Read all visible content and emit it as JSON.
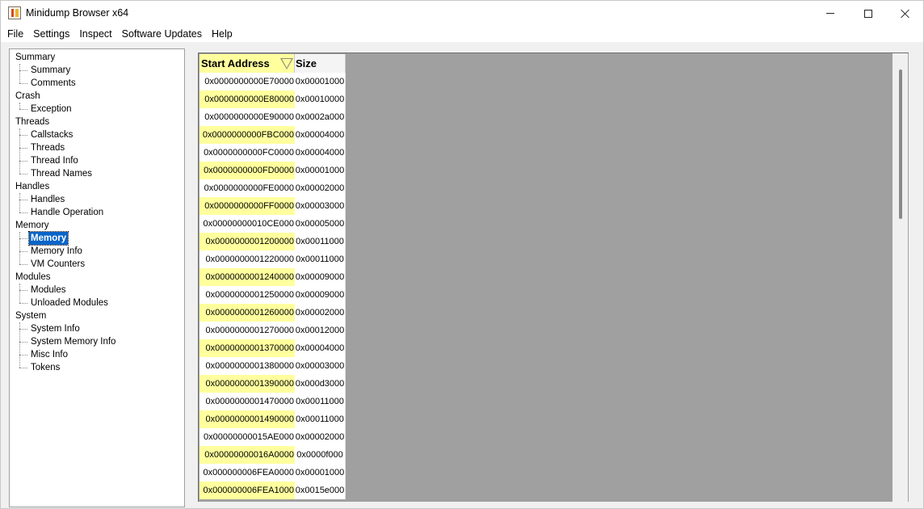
{
  "window": {
    "title": "Minidump Browser x64"
  },
  "menu": [
    {
      "label": "File"
    },
    {
      "label": "Settings"
    },
    {
      "label": "Inspect"
    },
    {
      "label": "Software Updates"
    },
    {
      "label": "Help"
    }
  ],
  "tree": [
    {
      "label": "Summary",
      "children": [
        {
          "label": "Summary"
        },
        {
          "label": "Comments"
        }
      ]
    },
    {
      "label": "Crash",
      "children": [
        {
          "label": "Exception"
        }
      ]
    },
    {
      "label": "Threads",
      "children": [
        {
          "label": "Callstacks"
        },
        {
          "label": "Threads"
        },
        {
          "label": "Thread Info"
        },
        {
          "label": "Thread Names"
        }
      ]
    },
    {
      "label": "Handles",
      "children": [
        {
          "label": "Handles"
        },
        {
          "label": "Handle Operation"
        }
      ]
    },
    {
      "label": "Memory",
      "children": [
        {
          "label": "Memory",
          "selected": true
        },
        {
          "label": "Memory Info"
        },
        {
          "label": "VM Counters"
        }
      ]
    },
    {
      "label": "Modules",
      "children": [
        {
          "label": "Modules"
        },
        {
          "label": "Unloaded Modules"
        }
      ]
    },
    {
      "label": "System",
      "children": [
        {
          "label": "System Info"
        },
        {
          "label": "System Memory Info"
        },
        {
          "label": "Misc Info"
        },
        {
          "label": "Tokens"
        }
      ]
    }
  ],
  "grid": {
    "columns": [
      "Start Address",
      "Size"
    ],
    "sort_column": "Start Address",
    "sort_direction": "descending",
    "rows": [
      [
        "0x0000000000E70000",
        "0x00001000"
      ],
      [
        "0x0000000000E80000",
        "0x00010000"
      ],
      [
        "0x0000000000E90000",
        "0x0002a000"
      ],
      [
        "0x0000000000FBC000",
        "0x00004000"
      ],
      [
        "0x0000000000FC0000",
        "0x00004000"
      ],
      [
        "0x0000000000FD0000",
        "0x00001000"
      ],
      [
        "0x0000000000FE0000",
        "0x00002000"
      ],
      [
        "0x0000000000FF0000",
        "0x00003000"
      ],
      [
        "0x00000000010CE000",
        "0x00005000"
      ],
      [
        "0x0000000001200000",
        "0x00011000"
      ],
      [
        "0x0000000001220000",
        "0x00011000"
      ],
      [
        "0x0000000001240000",
        "0x00009000"
      ],
      [
        "0x0000000001250000",
        "0x00009000"
      ],
      [
        "0x0000000001260000",
        "0x00002000"
      ],
      [
        "0x0000000001270000",
        "0x00012000"
      ],
      [
        "0x0000000001370000",
        "0x00004000"
      ],
      [
        "0x0000000001380000",
        "0x00003000"
      ],
      [
        "0x0000000001390000",
        "0x000d3000"
      ],
      [
        "0x0000000001470000",
        "0x00011000"
      ],
      [
        "0x0000000001490000",
        "0x00011000"
      ],
      [
        "0x00000000015AE000",
        "0x00002000"
      ],
      [
        "0x00000000016A0000",
        "0x0000f000"
      ],
      [
        "0x000000006FEA0000",
        "0x00001000"
      ],
      [
        "0x000000006FEA1000",
        "0x0015e000"
      ]
    ]
  },
  "colors": {
    "highlight_yellow": "#ffff9e",
    "selection_blue": "#0a64c8",
    "empty_grid_gray": "#a0a0a0"
  }
}
